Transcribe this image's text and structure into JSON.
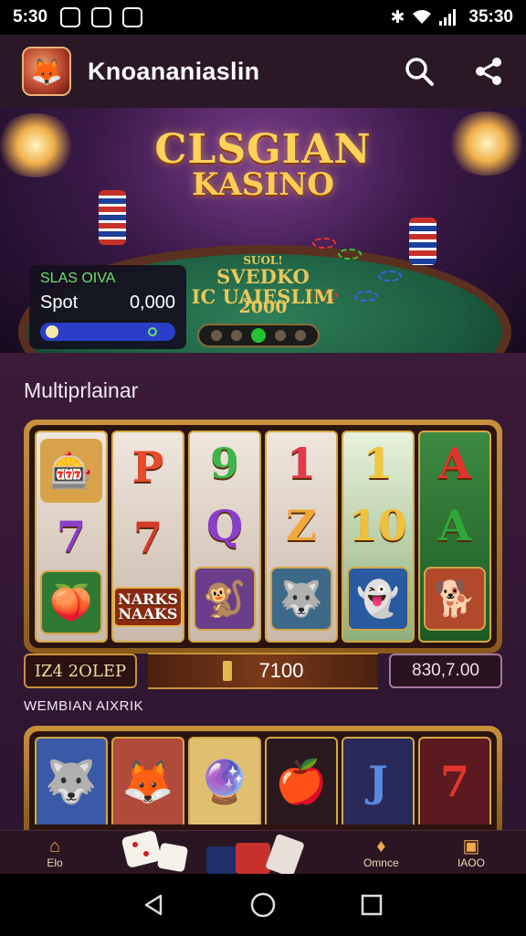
{
  "status_bar": {
    "time_left": "5:30",
    "time_right": "35:30"
  },
  "app_bar": {
    "title": "Knoananiaslin"
  },
  "hero": {
    "title_line1": "CLSGIAN",
    "title_line2": "KASINO",
    "table_text_1": "SUOL!",
    "table_text_2": "SVEDKO",
    "table_text_3": "IC UAIESLIM",
    "table_text_4": "2000",
    "promo": {
      "name": "SLAS OIVA",
      "label": "Spot",
      "value": "0,000"
    }
  },
  "section1": {
    "title": "Multiprlainar",
    "reels": [
      [
        "🎰",
        "7",
        "🍑"
      ],
      [
        "P",
        "7",
        "NARKS NAAKS"
      ],
      [
        "9",
        "Q",
        "🐒"
      ],
      [
        "1",
        "Z",
        "🐺"
      ],
      [
        "1",
        "10",
        "👻"
      ],
      [
        "A",
        "A",
        "🐕"
      ]
    ],
    "bar_left": "IZ4 2OLEP",
    "bar_mid": "7100",
    "bar_right": "830,7.00"
  },
  "section2": {
    "title": "WEMBIAN AIXRIK",
    "reels": [
      "🐺",
      "🦊",
      "🔮",
      "🍎",
      "J",
      "7"
    ]
  },
  "bottom_nav": {
    "items": [
      {
        "icon": "home-icon",
        "label": "Elo"
      },
      {
        "icon": "bonus-icon",
        "label": "Omnce"
      },
      {
        "icon": "profile-icon",
        "label": "IAOO"
      }
    ]
  },
  "colors": {
    "accent": "#f0a84a",
    "gold": "#ffd25a",
    "background": "#2c1530",
    "green": "#22c232"
  }
}
